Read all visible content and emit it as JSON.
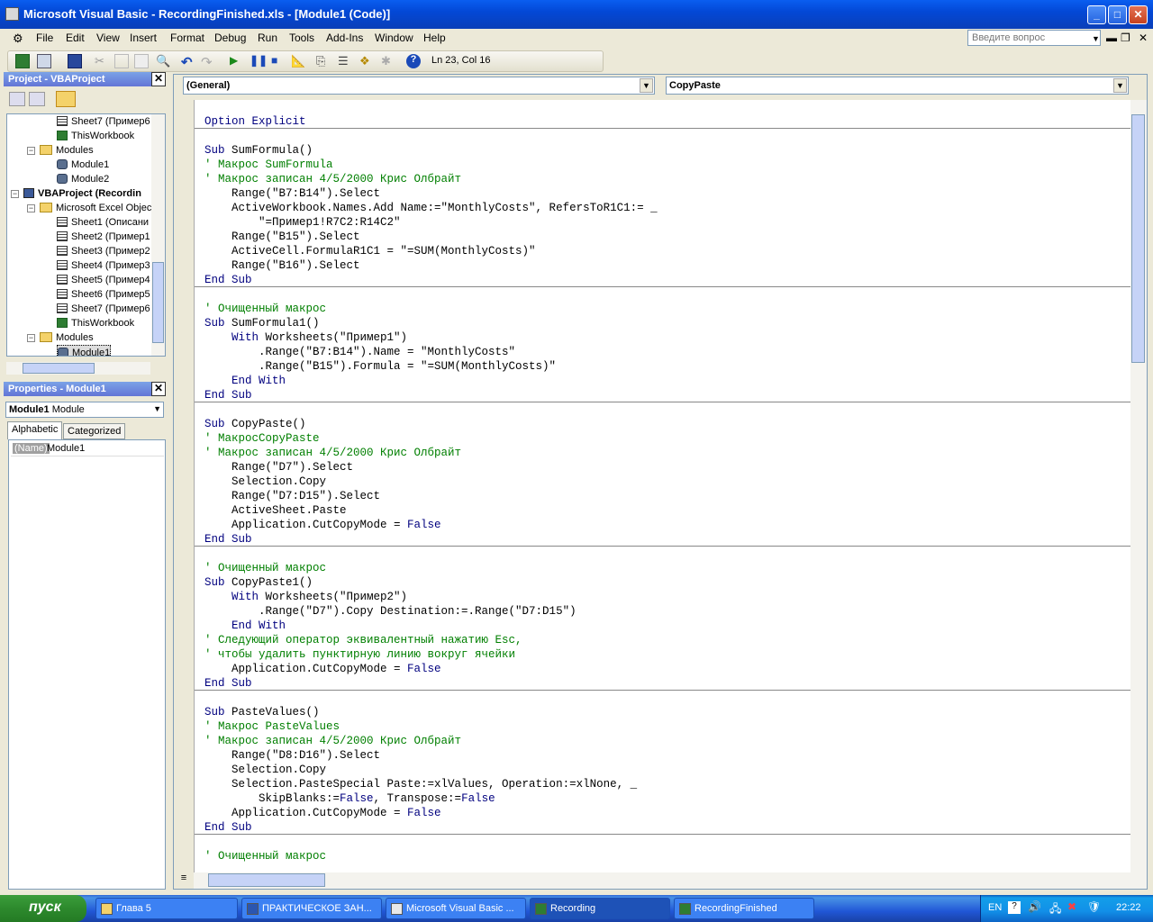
{
  "window": {
    "title": "Microsoft Visual Basic - RecordingFinished.xls - [Module1 (Code)]"
  },
  "menu": [
    "File",
    "Edit",
    "View",
    "Insert",
    "Format",
    "Debug",
    "Run",
    "Tools",
    "Add-Ins",
    "Window",
    "Help"
  ],
  "ask_placeholder": "Введите вопрос",
  "toolbar": {
    "position": "Ln 23, Col 16"
  },
  "project": {
    "title": "Project - VBAProject",
    "nodes": [
      {
        "label": "Sheet7 (Пример6",
        "icon": "sheet"
      },
      {
        "label": "ThisWorkbook",
        "icon": "workbook"
      },
      {
        "label": "Modules",
        "icon": "folder"
      },
      {
        "label": "Module1",
        "icon": "module"
      },
      {
        "label": "Module2",
        "icon": "module"
      },
      {
        "label": "VBAProject (Recordin",
        "icon": "vba-project"
      },
      {
        "label": "Microsoft Excel Objec",
        "icon": "folder"
      },
      {
        "label": "Sheet1 (Описани",
        "icon": "sheet"
      },
      {
        "label": "Sheet2 (Пример1",
        "icon": "sheet"
      },
      {
        "label": "Sheet3 (Пример2",
        "icon": "sheet"
      },
      {
        "label": "Sheet4 (Пример3",
        "icon": "sheet"
      },
      {
        "label": "Sheet5 (Пример4",
        "icon": "sheet"
      },
      {
        "label": "Sheet6 (Пример5",
        "icon": "sheet"
      },
      {
        "label": "Sheet7 (Пример6",
        "icon": "sheet"
      },
      {
        "label": "ThisWorkbook",
        "icon": "workbook"
      },
      {
        "label": "Modules",
        "icon": "folder"
      },
      {
        "label": "Module1",
        "icon": "module"
      }
    ]
  },
  "properties": {
    "title": "Properties - Module1",
    "object_name": "Module1",
    "object_type": "Module",
    "tabs": [
      "Alphabetic",
      "Categorized"
    ],
    "row_name": "(Name)",
    "row_value": "Module1"
  },
  "code": {
    "object_combo": "(General)",
    "proc_combo": "CopyPaste",
    "lines": [
      {
        "t": "Option Explicit",
        "c": "kw"
      },
      {
        "t": "",
        "c": ""
      },
      {
        "t": "Sub SumFormula()",
        "c": "sub"
      },
      {
        "t": "' Макрос SumFormula",
        "c": "cm"
      },
      {
        "t": "' Макрос записан 4/5/2000 Крис Олбрайт",
        "c": "cm"
      },
      {
        "t": "    Range(\"B7:B14\").Select",
        "c": ""
      },
      {
        "t": "    ActiveWorkbook.Names.Add Name:=\"MonthlyCosts\", RefersToR1C1:= _",
        "c": ""
      },
      {
        "t": "        \"=Пример1!R7C2:R14C2\"",
        "c": ""
      },
      {
        "t": "    Range(\"B15\").Select",
        "c": ""
      },
      {
        "t": "    ActiveCell.FormulaR1C1 = \"=SUM(MonthlyCosts)\"",
        "c": ""
      },
      {
        "t": "    Range(\"B16\").Select",
        "c": ""
      },
      {
        "t": "End Sub",
        "c": "kw"
      },
      {
        "t": "",
        "c": ""
      },
      {
        "t": "' Очищенный макрос",
        "c": "cm"
      },
      {
        "t": "Sub SumFormula1()",
        "c": "sub"
      },
      {
        "t": "    With Worksheets(\"Пример1\")",
        "c": "with"
      },
      {
        "t": "        .Range(\"B7:B14\").Name = \"MonthlyCosts\"",
        "c": ""
      },
      {
        "t": "        .Range(\"B15\").Formula = \"=SUM(MonthlyCosts)\"",
        "c": ""
      },
      {
        "t": "    End With",
        "c": "kw"
      },
      {
        "t": "End Sub",
        "c": "kw"
      },
      {
        "t": "",
        "c": ""
      },
      {
        "t": "Sub CopyPaste()",
        "c": "sub"
      },
      {
        "t": "' МакросCopyPaste",
        "c": "cm"
      },
      {
        "t": "' Макрос записан 4/5/2000 Крис Олбрайт",
        "c": "cm"
      },
      {
        "t": "    Range(\"D7\").Select",
        "c": ""
      },
      {
        "t": "    Selection.Copy",
        "c": ""
      },
      {
        "t": "    Range(\"D7:D15\").Select",
        "c": ""
      },
      {
        "t": "    ActiveSheet.Paste",
        "c": ""
      },
      {
        "t": "    Application.CutCopyMode = False",
        "c": "false"
      },
      {
        "t": "End Sub",
        "c": "kw"
      },
      {
        "t": "",
        "c": ""
      },
      {
        "t": "' Очищенный макрос",
        "c": "cm"
      },
      {
        "t": "Sub CopyPaste1()",
        "c": "sub"
      },
      {
        "t": "    With Worksheets(\"Пример2\")",
        "c": "with"
      },
      {
        "t": "        .Range(\"D7\").Copy Destination:=.Range(\"D7:D15\")",
        "c": ""
      },
      {
        "t": "    End With",
        "c": "kw"
      },
      {
        "t": "' Следующий оператор эквивалентный нажатию Esc,",
        "c": "cm"
      },
      {
        "t": "' чтобы удалить пунктирную линию вокруг ячейки",
        "c": "cm"
      },
      {
        "t": "    Application.CutCopyMode = False",
        "c": "false"
      },
      {
        "t": "End Sub",
        "c": "kw"
      },
      {
        "t": "",
        "c": ""
      },
      {
        "t": "Sub PasteValues()",
        "c": "sub"
      },
      {
        "t": "' Макрос PasteValues",
        "c": "cm"
      },
      {
        "t": "' Макрос записан 4/5/2000 Крис Олбрайт",
        "c": "cm"
      },
      {
        "t": "    Range(\"D8:D16\").Select",
        "c": ""
      },
      {
        "t": "    Selection.Copy",
        "c": ""
      },
      {
        "t": "    Selection.PasteSpecial Paste:=xlValues, Operation:=xlNone, _",
        "c": ""
      },
      {
        "t": "        SkipBlanks:=False, Transpose:=False",
        "c": "false2"
      },
      {
        "t": "    Application.CutCopyMode = False",
        "c": "false"
      },
      {
        "t": "End Sub",
        "c": "kw"
      },
      {
        "t": "",
        "c": ""
      },
      {
        "t": "' Очищенный макрос",
        "c": "cm"
      }
    ]
  },
  "taskbar": {
    "start": "пуск",
    "tasks": [
      "Глава 5",
      "ПРАКТИЧЕСКОЕ ЗАН...",
      "Microsoft Visual Basic ...",
      "Recording",
      "RecordingFinished"
    ],
    "lang": "EN",
    "clock": "22:22"
  },
  "colors": {
    "keyword": "#00007f",
    "comment": "#007f00",
    "titlebar": "#0a5ef0"
  }
}
